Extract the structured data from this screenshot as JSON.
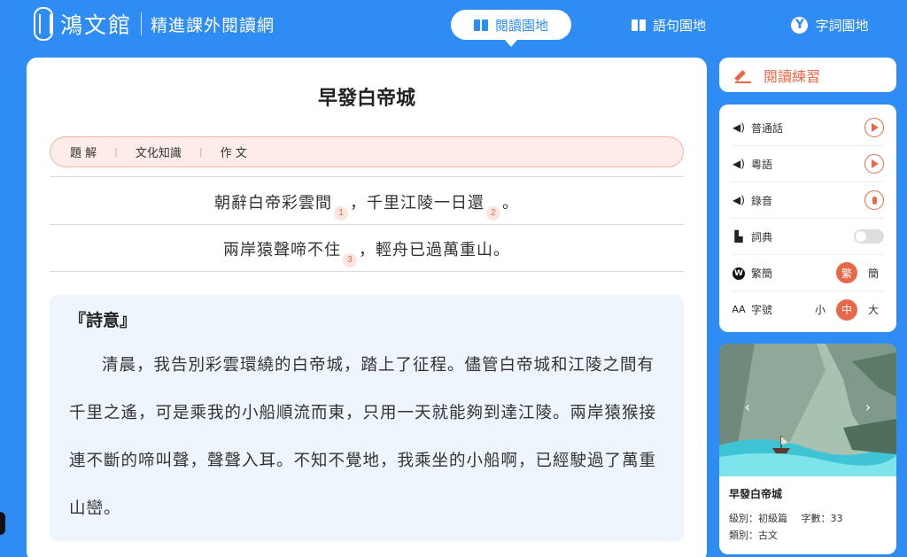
{
  "brand": {
    "name": "鴻文館",
    "subtitle": "精進課外閱讀網"
  },
  "nav": [
    {
      "label": "閱讀園地",
      "icon": "book-icon",
      "active": true
    },
    {
      "label": "語句園地",
      "icon": "book-icon",
      "active": false
    },
    {
      "label": "字詞園地",
      "icon": "y-circle-icon",
      "active": false
    }
  ],
  "article": {
    "title": "早發白帝城",
    "tabs": [
      "題 解",
      "文化知識",
      "作 文"
    ],
    "lines": [
      {
        "a": "朝辭白帝彩雲間",
        "na": "1",
        "mid": "，千里江陵一日還",
        "nb": "2",
        "end": "。"
      },
      {
        "a": "兩岸猿聲啼不住",
        "na": "3",
        "mid": "，輕舟已過萬重山",
        "end": "。"
      }
    ],
    "meaning_heading": "『詩意』",
    "meaning_text": "清晨，我告別彩雲環繞的白帝城，踏上了征程。儘管白帝城和江陵之間有千里之遙，可是乘我的小船順流而東，只用一天就能夠到達江陵。兩岸猿猴接連不斷的啼叫聲，聲聲入耳。不知不覺地，我乘坐的小船啊，已經駛過了萬重山巒。"
  },
  "sidebar": {
    "practice_label": "閱讀練習",
    "controls": {
      "mandarin": "普通話",
      "cantonese": "粵語",
      "record": "錄音",
      "dictionary": "詞典",
      "script": {
        "label": "繁簡",
        "options": [
          "繁",
          "簡"
        ],
        "selected": "繁"
      },
      "fontsize": {
        "label": "字號",
        "options": [
          "小",
          "中",
          "大"
        ],
        "selected": "中"
      }
    },
    "card": {
      "title": "早發白帝城",
      "level_label": "級別：初級篇",
      "count_label": "字數：33",
      "type_label": "類別：古文"
    }
  },
  "colors": {
    "primary": "#2f8cf5",
    "accent": "#e8694a",
    "meaning_bg": "#eef5fd"
  }
}
